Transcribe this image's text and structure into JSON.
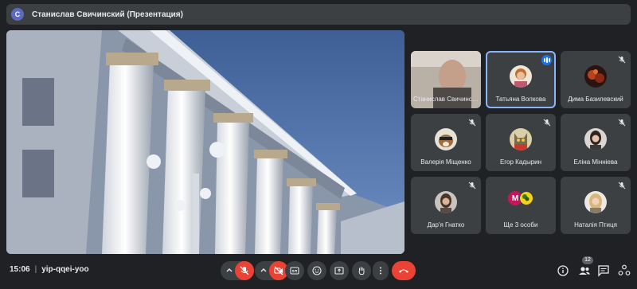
{
  "presenter": {
    "initial": "С",
    "label": "Станислав Свичинский (Презентация)"
  },
  "participants": [
    {
      "name": "Станислав Свичинский",
      "muted": false
    },
    {
      "name": "Татьяна Волкова",
      "speaking": true
    },
    {
      "name": "Дима Базилевский",
      "muted": true
    },
    {
      "name": "Валерія Міщенко",
      "muted": true
    },
    {
      "name": "Егор Кадырин",
      "muted": true
    },
    {
      "name": "Еліна Мінніева",
      "muted": true
    },
    {
      "name": "Дар'я Гнатко",
      "muted": true
    },
    {
      "name": "Ще 3 особи",
      "initial": "М",
      "muted": false
    },
    {
      "name": "Наталія Птиця",
      "muted": true
    }
  ],
  "meeting": {
    "time": "15:06",
    "code": "yip-qqei-yoo"
  },
  "participants_count": "12",
  "colors": {
    "end_call": "#ea4335",
    "speaking_outline": "#8ab4f8",
    "tile_bg": "#3c4043"
  },
  "controls": [
    "mic-off",
    "camera-off",
    "captions",
    "emoji",
    "present",
    "raise-hand",
    "more-options",
    "end-call"
  ],
  "right_controls": [
    "info",
    "people",
    "chat",
    "activities"
  ]
}
